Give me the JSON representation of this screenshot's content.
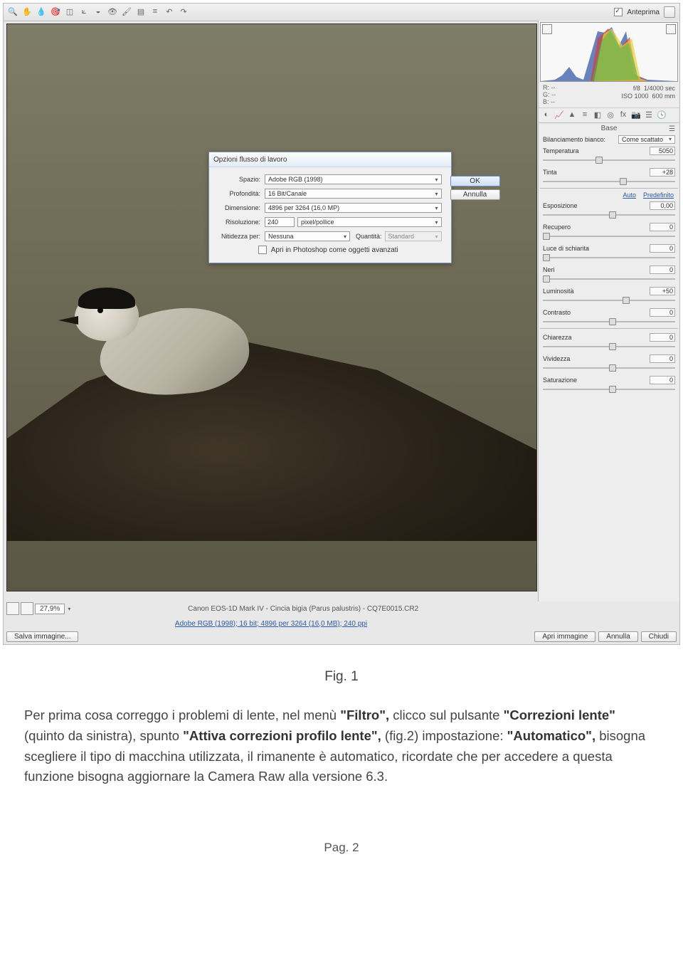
{
  "toolbar": {
    "preview_label": "Anteprima"
  },
  "dialog": {
    "title": "Opzioni flusso di lavoro",
    "space_label": "Spazio:",
    "space_value": "Adobe RGB (1998)",
    "depth_label": "Profondità:",
    "depth_value": "16 Bit/Canale",
    "dim_label": "Dimensione:",
    "dim_value": "4896 per 3264 (16,0 MP)",
    "res_label": "Risoluzione:",
    "res_value": "240",
    "res_unit": "pixel/pollice",
    "sharp_label": "Nitidezza per:",
    "sharp_value": "Nessuna",
    "qty_label": "Quantità:",
    "qty_value": "Standard",
    "open_as_smart": "Apri in Photoshop come oggetti avanzati",
    "ok": "OK",
    "cancel": "Annulla"
  },
  "meta": {
    "r": "R:",
    "r_v": "--",
    "g": "G:",
    "g_v": "--",
    "b": "B:",
    "b_v": "--",
    "aperture": "f/8",
    "shutter": "1/4000 sec",
    "iso": "ISO 1000",
    "focal": "600 mm"
  },
  "panel": {
    "section": "Base",
    "wb_label": "Bilanciamento bianco:",
    "wb_value": "Come scattato",
    "temp_label": "Temperatura",
    "temp_value": "5050",
    "tint_label": "Tinta",
    "tint_value": "+28",
    "auto_label": "Auto",
    "default_label": "Predefinito",
    "exposure_label": "Esposizione",
    "exposure_value": "0,00",
    "recovery_label": "Recupero",
    "recovery_value": "0",
    "fill_label": "Luce di schiarita",
    "fill_value": "0",
    "blacks_label": "Neri",
    "blacks_value": "0",
    "brightness_label": "Luminosità",
    "brightness_value": "+50",
    "contrast_label": "Contrasto",
    "contrast_value": "0",
    "clarity_label": "Chiarezza",
    "clarity_value": "0",
    "vibrance_label": "Vividezza",
    "vibrance_value": "0",
    "saturation_label": "Saturazione",
    "saturation_value": "0"
  },
  "footer": {
    "zoom": "27,9%",
    "center": "Canon EOS-1D Mark IV - Cincia bigia (Parus palustris) - CQ7E0015.CR2",
    "link": "Adobe RGB (1998); 16 bit; 4896 per 3264 (16,0 MB); 240 ppi",
    "save": "Salva immagine...",
    "open": "Apri immagine",
    "cancel": "Annulla",
    "done": "Chiudi"
  },
  "article": {
    "caption": "Fig. 1",
    "p1a": "Per prima cosa correggo i problemi di lente, nel menù ",
    "p1b": "\"Filtro\",",
    "p2a": "clicco sul pulsante ",
    "p2b": "\"Correzioni lente\"",
    "p2c": " (quinto da sinistra), spunto ",
    "p3a": "\"Attiva correzioni profilo lente\",",
    "p3b": " (fig.2) impostazione: ",
    "p4a": "\"Automatico\",",
    "p4b": " bisogna  scegliere il tipo di macchina utilizzata, il rimanente è automatico, ricordate che per accedere a questa funzione bisogna aggiornare la Camera Raw alla versione 6.3.",
    "page": "Pag. 2"
  }
}
